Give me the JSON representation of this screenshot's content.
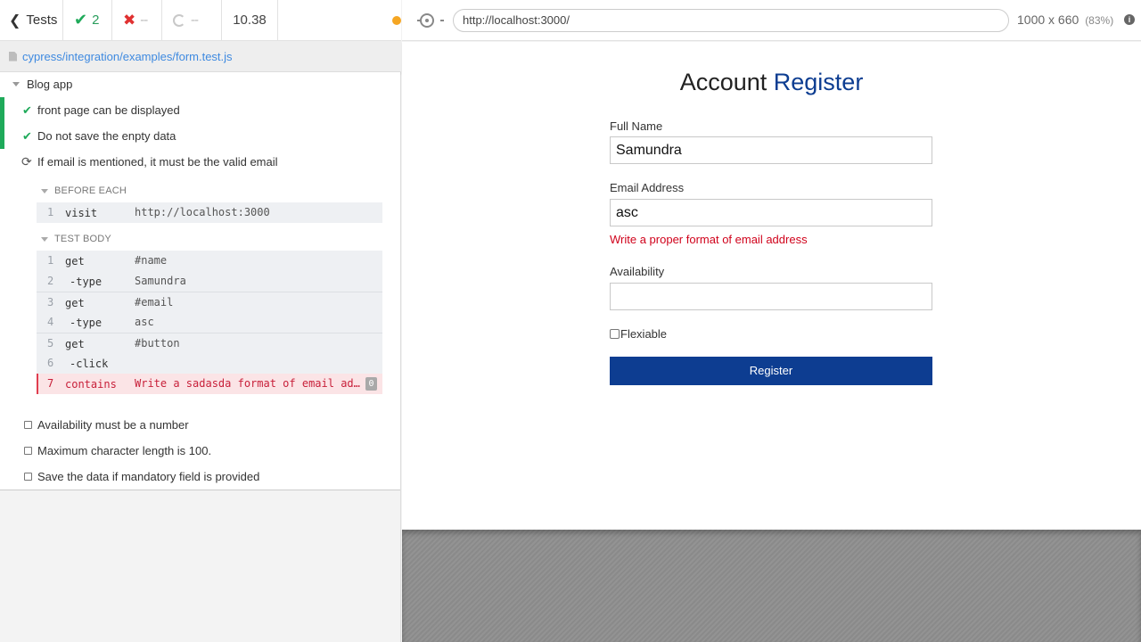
{
  "stats": {
    "back_label": "Tests",
    "passed": "2",
    "failed": "--",
    "pending": "--",
    "duration": "10.38"
  },
  "spec": {
    "path": "cypress/integration/examples/form.test.js"
  },
  "suite": {
    "title": "Blog app",
    "tests": [
      {
        "title": "front page can be displayed",
        "state": "passed"
      },
      {
        "title": "Do not save the enpty data",
        "state": "passed"
      },
      {
        "title": "If email is mentioned, it must be the valid email",
        "state": "running"
      },
      {
        "title": "Availability must be a number",
        "state": "pending"
      },
      {
        "title": "Maximum character length is 100.",
        "state": "pending"
      },
      {
        "title": "Save the data if mandatory field is provided",
        "state": "pending"
      }
    ]
  },
  "hooks": {
    "before_each": {
      "title": "BEFORE EACH",
      "commands": [
        {
          "num": "1",
          "name": "visit",
          "message": "http://localhost:3000"
        }
      ]
    },
    "test_body": {
      "title": "TEST BODY",
      "commands": [
        {
          "num": "1",
          "name": "get",
          "message": "#name"
        },
        {
          "num": "2",
          "name": "-type",
          "message": "Samundra"
        },
        {
          "num": "3",
          "name": "get",
          "message": "#email"
        },
        {
          "num": "4",
          "name": "-type",
          "message": "asc"
        },
        {
          "num": "5",
          "name": "get",
          "message": "#button"
        },
        {
          "num": "6",
          "name": "-click",
          "message": ""
        },
        {
          "num": "7",
          "name": "contains",
          "message": "Write a sadasda format of email address",
          "badge": "0",
          "state": "failed"
        }
      ]
    }
  },
  "aut": {
    "url": "http://localhost:3000/",
    "viewport": "1000 x 660",
    "scale": "(83%)"
  },
  "form": {
    "title_prefix": "Account",
    "title_accent": "Register",
    "name_label": "Full Name",
    "name_value": "Samundra",
    "email_label": "Email Address",
    "email_value": "asc",
    "email_error": "Write a proper format of email address",
    "availability_label": "Availability",
    "availability_value": "",
    "flexible_label": "Flexiable",
    "submit_label": "Register"
  },
  "colors": {
    "pass": "#1faa5a",
    "fail": "#e03131",
    "brand": "#0d3d91",
    "error": "#d0021b"
  }
}
